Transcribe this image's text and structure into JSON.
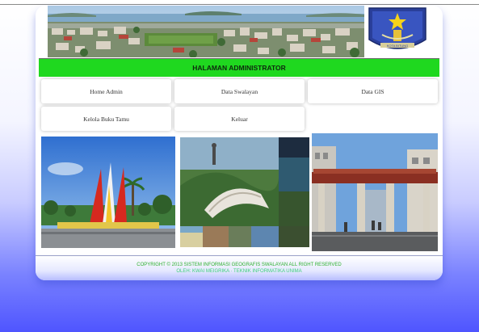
{
  "header": {
    "title": "HALAMAN ADMINISTRATOR",
    "logo_caption": "KOTA BITUNG"
  },
  "nav": {
    "items": [
      {
        "label": "Home Admin"
      },
      {
        "label": "Data Swalayan"
      },
      {
        "label": "Data GIS"
      },
      {
        "label": "Kelola Buku Tamu"
      },
      {
        "label": "Keluar"
      }
    ]
  },
  "footer": {
    "copyright": "COPYRIGHT © 2013 SISTEM INFORMASI GEOGRAFIS SWALAYAN ALL RIGHT RESERVED",
    "credit": "OLEH: KWAI MEIGRIKA · TEKNIK INFORMATIKA UNIMA"
  },
  "colors": {
    "title_bar": "#1fd81f",
    "page_gradient_bottom": "#4f55ff",
    "footer_text": "#2fb02f"
  }
}
